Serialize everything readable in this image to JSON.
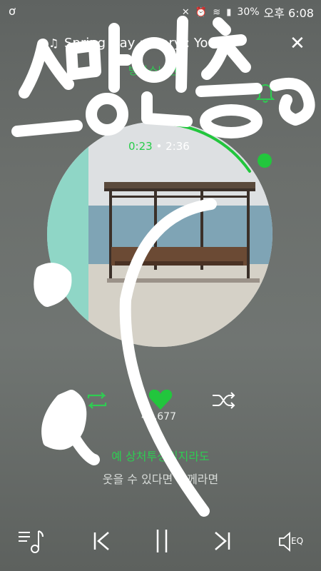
{
  "status_bar": {
    "left_icon": "circle-logo-icon",
    "icons": "✕ ⏰ ≋ ▮",
    "battery": "30%",
    "time": "오후 6:08"
  },
  "header": {
    "song_title": "Spring Day : Story : You",
    "artist": "방탄소년단",
    "close_label": "✕"
  },
  "player": {
    "current_time": "0:23",
    "separator": "•",
    "total_time": "2:36",
    "progress": 0.147,
    "accent_color": "#22c63d"
  },
  "actions": {
    "like_count": "47,677"
  },
  "lyrics": {
    "current": "예 상처투성일지라도",
    "next": "웃을 수 있다면 함께라면"
  },
  "bottom_bar": {
    "eq_label": "EQ"
  },
  "overlay": {
    "scribble_text": "스밍인증"
  }
}
